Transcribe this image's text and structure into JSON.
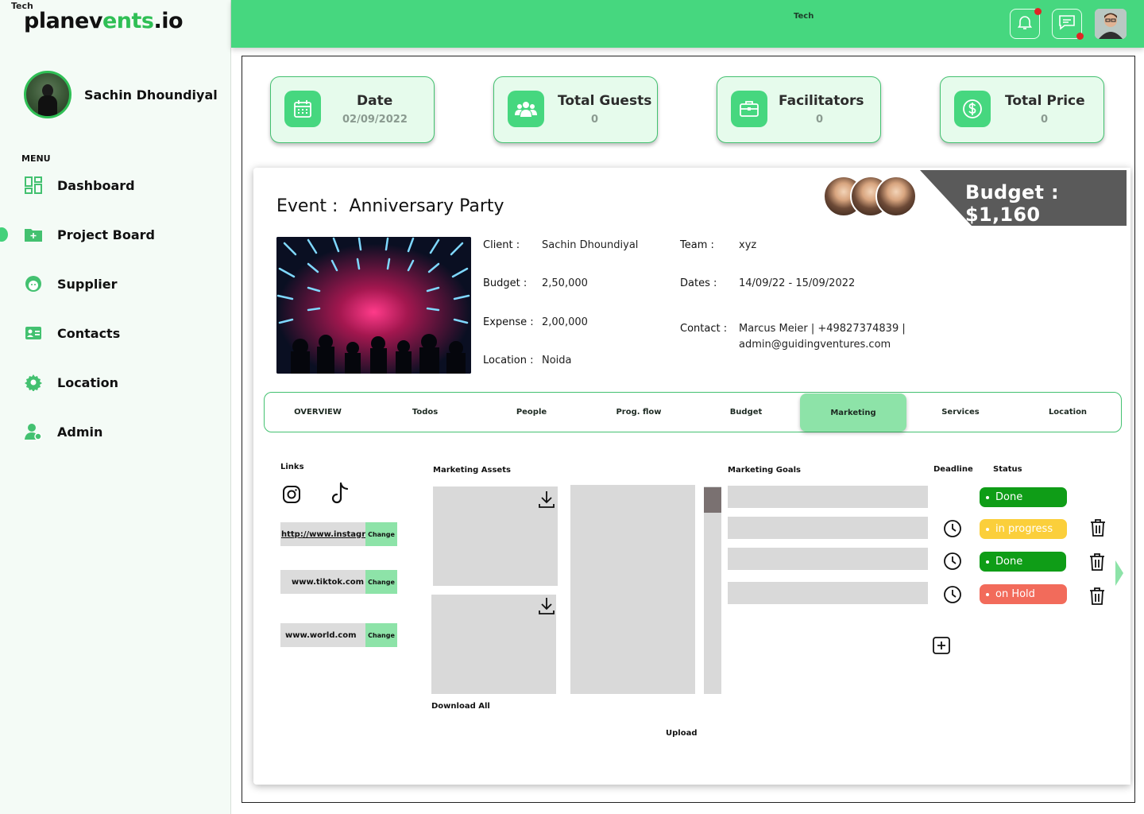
{
  "app": {
    "brand_small": "Tech",
    "brand_prefix": "planev",
    "brand_highlight": "ents",
    "brand_suffix": ".io"
  },
  "sidebar": {
    "user_name": "Sachin Dhoundiyal",
    "menu_title": "MENU",
    "items": [
      {
        "label": "Dashboard",
        "icon": "dashboard-icon"
      },
      {
        "label": "Project Board",
        "icon": "folder-plus-icon"
      },
      {
        "label": "Supplier",
        "icon": "supplier-face-icon"
      },
      {
        "label": "Contacts",
        "icon": "contact-card-icon"
      },
      {
        "label": "Location",
        "icon": "gear-location-icon"
      },
      {
        "label": "Admin",
        "icon": "admin-user-icon"
      }
    ],
    "active_item": "Project Board"
  },
  "topbar": {
    "title": "Tech",
    "icons": [
      "bell-icon",
      "message-icon",
      "user-avatar"
    ]
  },
  "stats": [
    {
      "title": "Date",
      "value": "02/09/2022",
      "icon": "calendar-icon"
    },
    {
      "title": "Total Guests",
      "value": "0",
      "icon": "guests-icon"
    },
    {
      "title": "Facilitators",
      "value": "0",
      "icon": "briefcase-icon"
    },
    {
      "title": "Total Price",
      "value": "0",
      "icon": "dollar-icon"
    }
  ],
  "event": {
    "title_label": "Event :",
    "title_value": "Anniversary Party",
    "budget_label": "Budget :",
    "budget_value": "$1,160",
    "client_label": "Client :",
    "client_value": "Sachin Dhoundiyal",
    "budget_field_label": "Budget :",
    "budget_field_value": "2,50,000",
    "expense_label": "Expense :",
    "expense_value": "2,00,000",
    "location_label": "Location :",
    "location_value": "Noida",
    "team_label": "Team :",
    "team_value": "xyz",
    "dates_label": "Dates :",
    "dates_value": "14/09/22 - 15/09/2022",
    "contact_label": "Contact :",
    "contact_line1": "Marcus Meier | +49827374839 |",
    "contact_line2": "admin@guidingventures.com"
  },
  "tabs": [
    {
      "label": "OVERVIEW",
      "active": false
    },
    {
      "label": "Todos",
      "active": false
    },
    {
      "label": "People",
      "active": false
    },
    {
      "label": "Prog. flow",
      "active": false
    },
    {
      "label": "Budget",
      "active": false
    },
    {
      "label": "Marketing",
      "active": true
    },
    {
      "label": "Services",
      "active": false
    },
    {
      "label": "Location",
      "active": false
    }
  ],
  "marketing": {
    "links_label": "Links",
    "links": [
      {
        "url": "http://www.instagra",
        "change": "Change"
      },
      {
        "url": "www.tiktok.com",
        "change": "Change"
      },
      {
        "url": "www.world.com",
        "change": "Change"
      }
    ],
    "assets_label": "Marketing Assets",
    "download_all": "Download All",
    "upload": "Upload",
    "goals_label": "Marketing Goals",
    "deadline_label": "Deadline",
    "status_label": "Status",
    "statuses": [
      {
        "label": "Done",
        "color": "#0f9d17"
      },
      {
        "label": "in progress",
        "color": "#fbcf3b"
      },
      {
        "label": "Done",
        "color": "#0f9d17"
      },
      {
        "label": "on Hold",
        "color": "#f26b5b"
      }
    ]
  },
  "colors": {
    "accent": "#46d77f",
    "accent_light": "#e6fbec",
    "tab_active": "#8de3a8",
    "banner": "#5a5a5a"
  }
}
